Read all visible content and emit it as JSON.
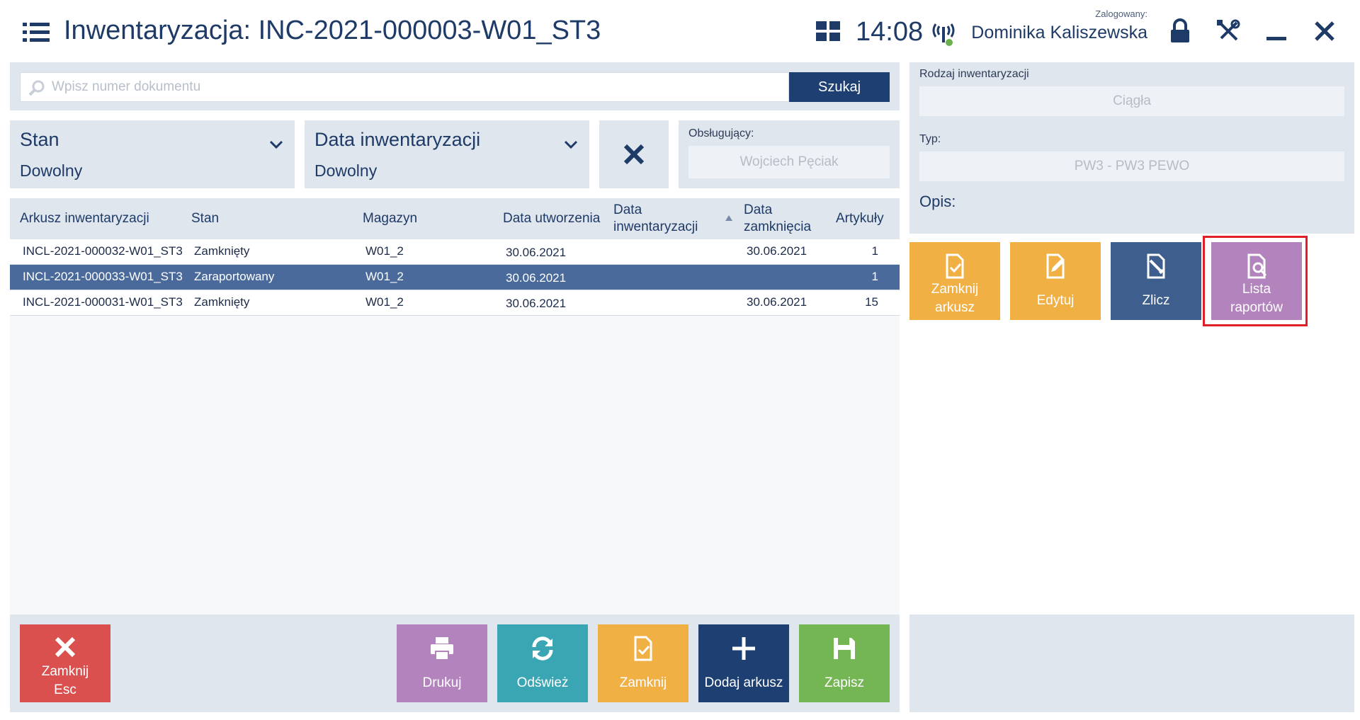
{
  "header": {
    "title": "Inwentaryzacja: INC-2021-000003-W01_ST3",
    "time": "14:08",
    "logged_caption": "Zalogowany:",
    "user_name": "Dominika Kaliszewska",
    "icons": [
      "menu-icon",
      "tiles-icon",
      "signal-icon",
      "lock-icon",
      "tools-icon",
      "minimize-icon",
      "close-icon"
    ]
  },
  "search": {
    "placeholder": "Wpisz numer dokumentu",
    "value": "",
    "button_label": "Szukaj"
  },
  "filters": {
    "state": {
      "label": "Stan",
      "value": "Dowolny"
    },
    "inventory_date": {
      "label": "Data inwentaryzacji",
      "value": "Dowolny"
    },
    "operator": {
      "label": "Obsługujący:",
      "value": "Wojciech Pęciak"
    }
  },
  "grid": {
    "columns": [
      "Arkusz inwentaryzacji",
      "Stan",
      "Magazyn",
      "Data utworzenia",
      "Data inwentaryzacji",
      "Data zamknięcia",
      "Artykuły"
    ],
    "sorted_column": "Data inwentaryzacji",
    "rows": [
      {
        "sheet": "INCL-2021-000032-W01_ST3",
        "state": "Zamknięty",
        "warehouse": "W01_2",
        "created": "30.06.2021",
        "inventory_date": "",
        "closed": "30.06.2021",
        "items": "1",
        "selected": false
      },
      {
        "sheet": "INCL-2021-000033-W01_ST3",
        "state": "Zaraportowany",
        "warehouse": "W01_2",
        "created": "30.06.2021",
        "inventory_date": "",
        "closed": "",
        "items": "1",
        "selected": true
      },
      {
        "sheet": "INCL-2021-000031-W01_ST3",
        "state": "Zamknięty",
        "warehouse": "W01_2",
        "created": "30.06.2021",
        "inventory_date": "",
        "closed": "30.06.2021",
        "items": "15",
        "selected": false
      }
    ]
  },
  "details": {
    "kind_label": "Rodzaj inwentaryzacji",
    "kind_value": "Ciągła",
    "type_label": "Typ:",
    "type_value": "PW3 - PW3 PEWO",
    "description_label": "Opis:"
  },
  "sheet_actions": [
    {
      "line1": "Zamknij",
      "line2": "arkusz",
      "color": "#f0b044",
      "icon": "close-sheet-icon"
    },
    {
      "line1": "Edytuj",
      "line2": "",
      "color": "#f0b044",
      "icon": "edit-icon"
    },
    {
      "line1": "Zlicz",
      "line2": "",
      "color": "#3e5f8e",
      "icon": "count-icon"
    },
    {
      "line1": "Lista",
      "line2": "raportów",
      "color": "#b383bd",
      "icon": "report-list-icon",
      "highlighted": true
    }
  ],
  "toolbar": {
    "close_esc": {
      "line1": "Zamknij",
      "line2": "Esc",
      "color": "#d9504f"
    },
    "print": {
      "label": "Drukuj",
      "color": "#b383bd"
    },
    "refresh": {
      "label": "Odśwież",
      "color": "#3aa6b3"
    },
    "close": {
      "label": "Zamknij",
      "color": "#f0b044"
    },
    "add_sheet": {
      "label": "Dodaj arkusz",
      "color": "#1e3f72"
    },
    "save": {
      "label": "Zapisz",
      "color": "#74b554"
    }
  }
}
